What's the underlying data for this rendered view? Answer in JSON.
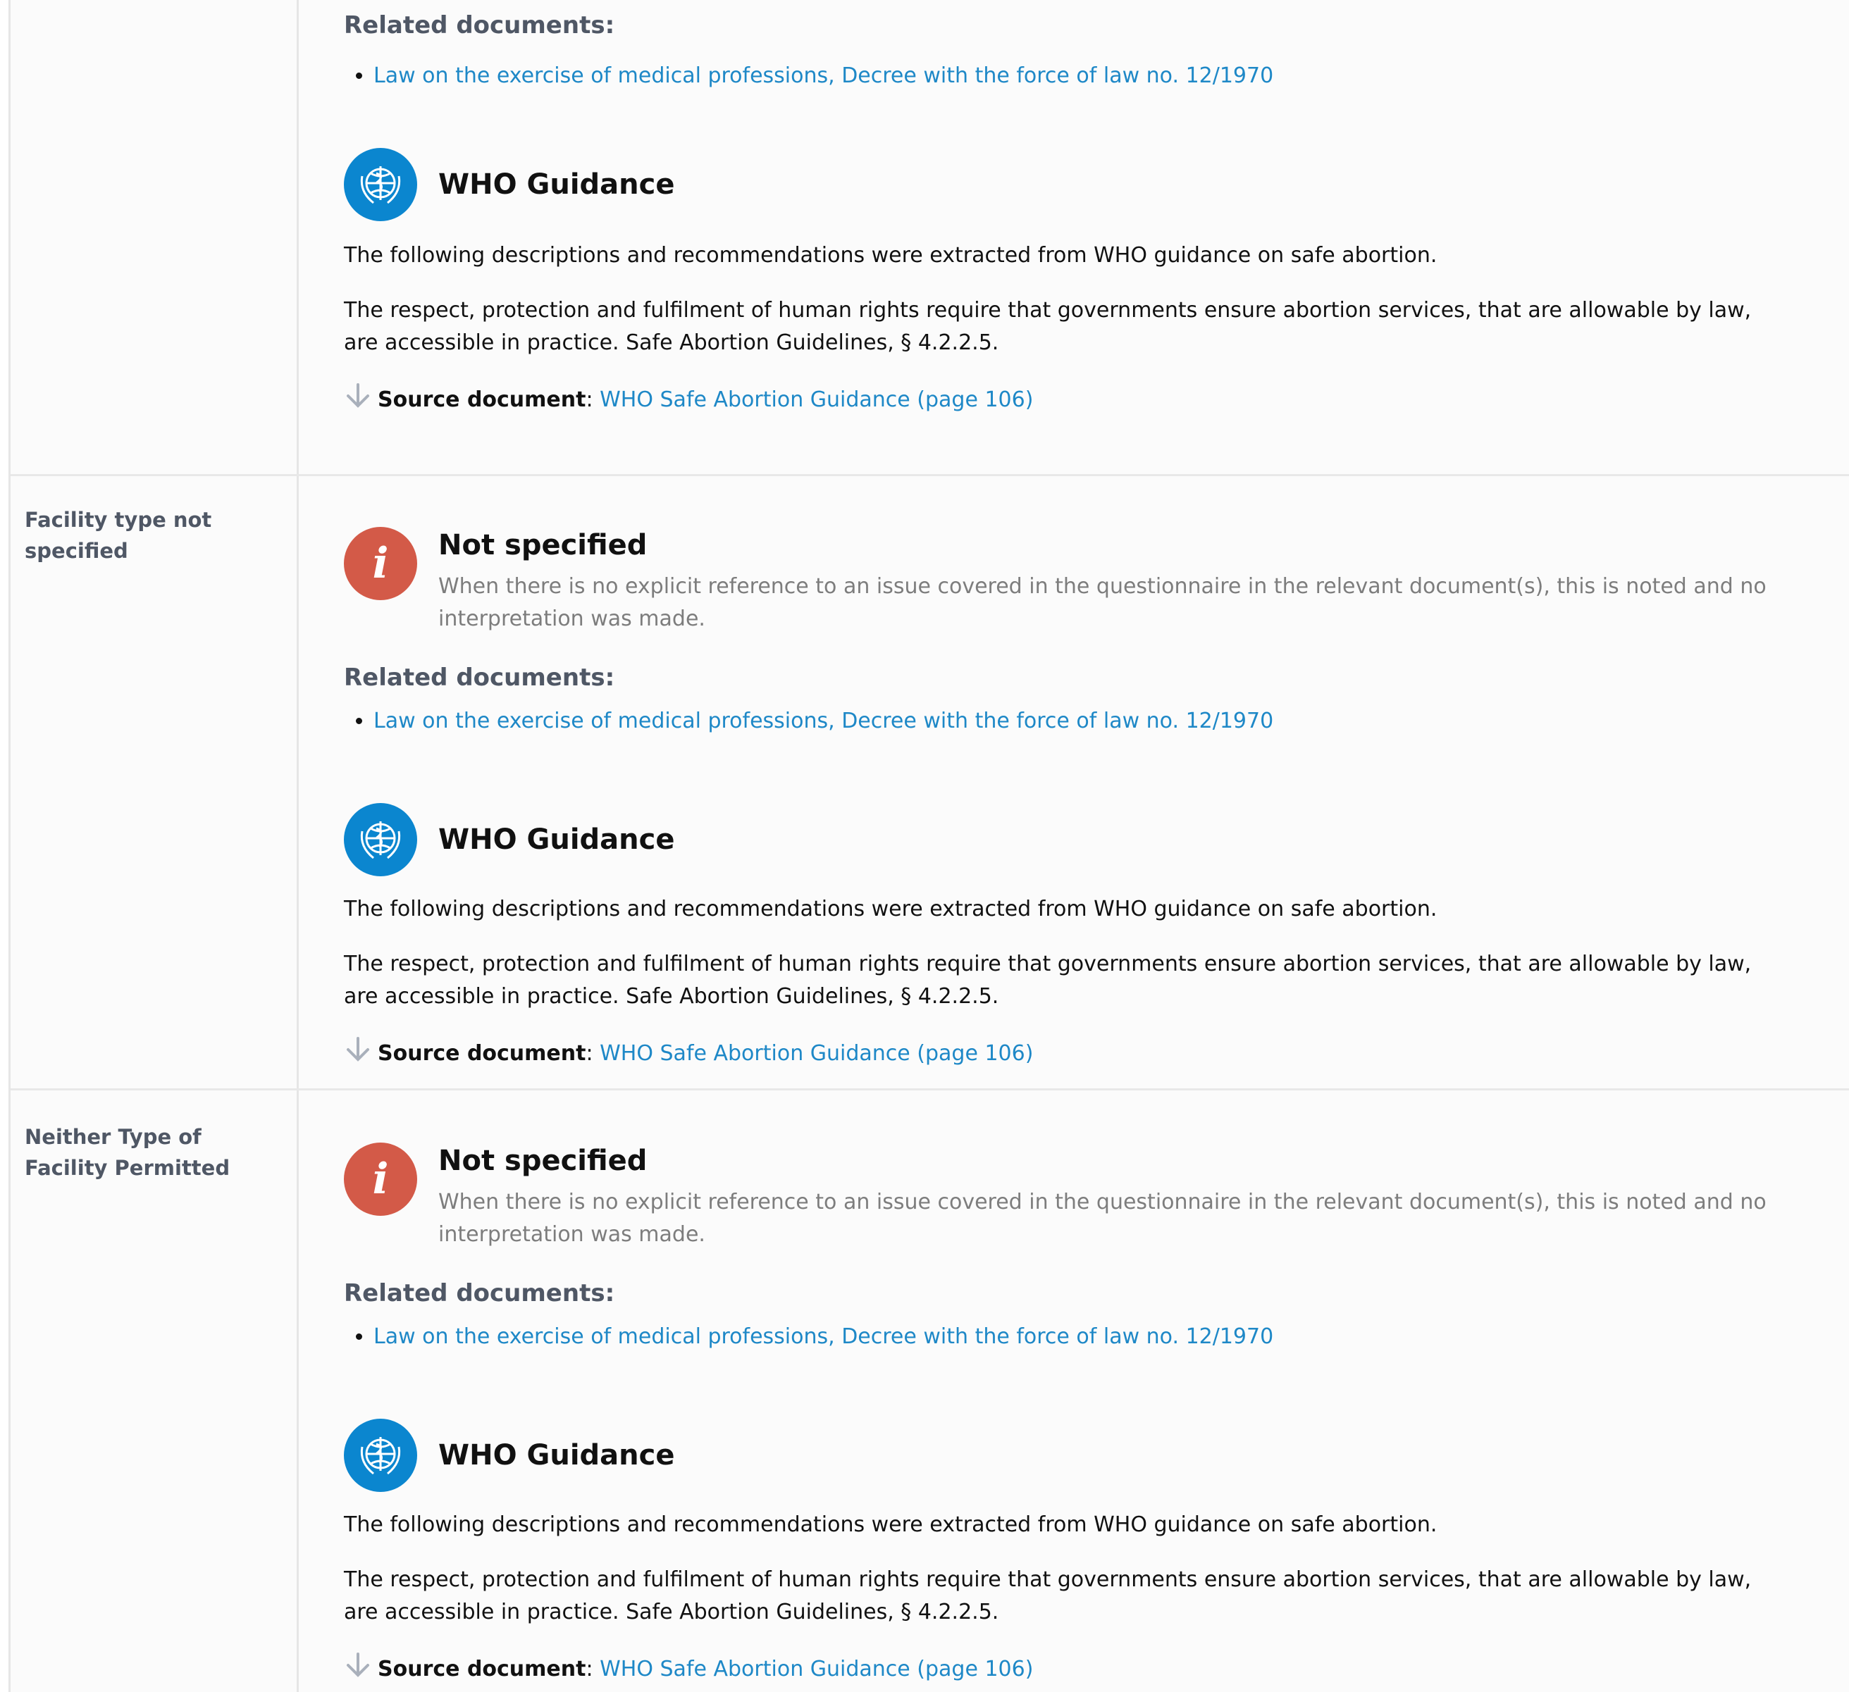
{
  "rows": [
    {
      "label": "",
      "not_specified": null,
      "related_heading": "Related documents:",
      "related_docs": [
        "Law on the exercise of medical professions, Decree with the force of law no. 12/1970"
      ],
      "who_title": "WHO Guidance",
      "who_intro": "The following descriptions and recommendations were extracted from WHO guidance on safe abortion.",
      "who_text": "The respect, protection and fulfilment of human rights require that governments ensure abortion services, that are allowable by law, are accessible in practice. Safe Abortion Guidelines, § 4.2.2.5.",
      "source_label": "Source document",
      "source_sep": ":",
      "source_link": "WHO Safe Abortion Guidance (page 106)"
    },
    {
      "label": "Facility type not specified",
      "not_specified": {
        "title": "Not specified",
        "desc": "When there is no explicit reference to an issue covered in the questionnaire in the relevant document(s), this is noted and no interpretation was made."
      },
      "related_heading": "Related documents:",
      "related_docs": [
        "Law on the exercise of medical professions, Decree with the force of law no. 12/1970"
      ],
      "who_title": "WHO Guidance",
      "who_intro": "The following descriptions and recommendations were extracted from WHO guidance on safe abortion.",
      "who_text": "The respect, protection and fulfilment of human rights require that governments ensure abortion services, that are allowable by law, are accessible in practice. Safe Abortion Guidelines, § 4.2.2.5.",
      "source_label": "Source document",
      "source_sep": ":",
      "source_link": "WHO Safe Abortion Guidance (page 106)"
    },
    {
      "label": "Neither Type of Facility Permitted",
      "not_specified": {
        "title": "Not specified",
        "desc": "When there is no explicit reference to an issue covered in the questionnaire in the relevant document(s), this is noted and no interpretation was made."
      },
      "related_heading": "Related documents:",
      "related_docs": [
        "Law on the exercise of medical professions, Decree with the force of law no. 12/1970"
      ],
      "who_title": "WHO Guidance",
      "who_intro": "The following descriptions and recommendations were extracted from WHO guidance on safe abortion.",
      "who_text": "The respect, protection and fulfilment of human rights require that governments ensure abortion services, that are allowable by law, are accessible in practice. Safe Abortion Guidelines, § 4.2.2.5.",
      "source_label": "Source document",
      "source_sep": ":",
      "source_link": "WHO Safe Abortion Guidance (page 106)"
    }
  ],
  "icons": {
    "who": "who-emblem-icon",
    "info": "info-icon",
    "download": "download-arrow-icon"
  },
  "colors": {
    "link": "#1e88c7",
    "who_blue": "#0b86cf",
    "info_red": "#d35a48",
    "muted_heading": "#4f5765"
  }
}
